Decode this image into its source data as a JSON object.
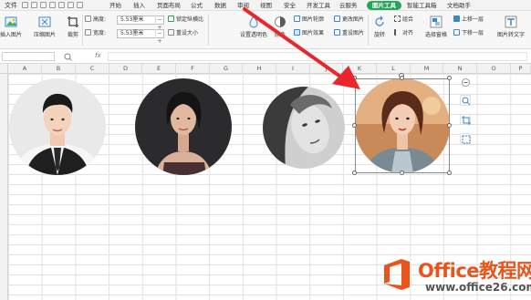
{
  "menubar": {
    "file_label": "文件",
    "tabs": [
      "开始",
      "插入",
      "页面布局",
      "公式",
      "数据",
      "审阅",
      "视图",
      "安全",
      "开发工具",
      "云服务",
      "图片工具",
      "智能工具箱",
      "文档助手"
    ],
    "active_tab": "图片工具"
  },
  "ribbon": {
    "insert_picture": "插入图片",
    "compress_picture": "压缩图片",
    "crop": "裁剪",
    "height_label": "高度:",
    "height_value": "5.53厘米",
    "width_label": "宽度:",
    "width_value": "5.53厘米",
    "lock_ratio": "锁定纵横比",
    "reset_size": "重设大小",
    "set_transparent": "设置透明色",
    "color": "颜色",
    "picture_outline": "图片轮廓",
    "picture_effect": "图片效果",
    "change_picture": "更改图片",
    "reset_picture": "重设图片",
    "rotate": "旋转",
    "group": "组合",
    "align": "对齐",
    "selection_pane": "选择窗格",
    "bring_forward": "上移一层",
    "send_backward": "下移一层",
    "picture_to_text": "图片转文字"
  },
  "columns": [
    "A",
    "B",
    "C",
    "D",
    "E",
    "F",
    "G",
    "H",
    "I",
    "J",
    "K",
    "L",
    "M",
    "N",
    "O",
    "P"
  ],
  "watermark": {
    "title": "Office教程网",
    "subtitle": "www.office26.com"
  },
  "colors": {
    "accent": "#26a55a",
    "watermark_orange": "#e8541c"
  }
}
